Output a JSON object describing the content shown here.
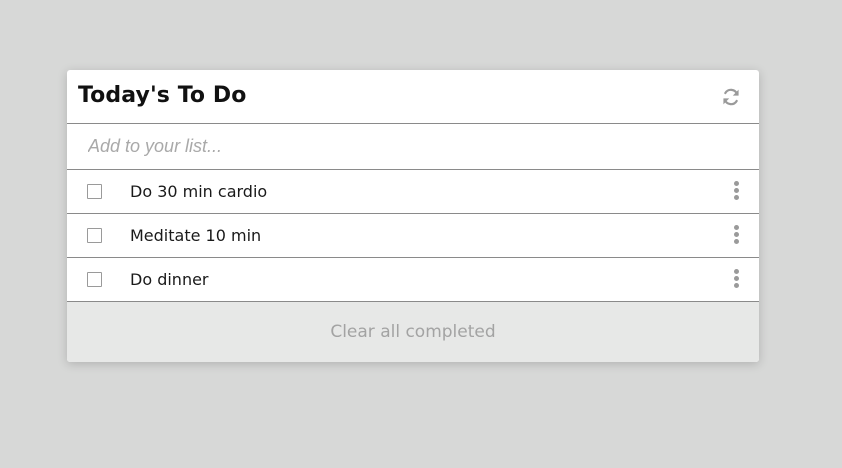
{
  "colors": {
    "page_background": "#d7d8d7",
    "card_background": "#ffffff",
    "footer_background": "#e7e8e7",
    "divider": "#8a8a8a",
    "icon_gray": "#9a9a9a"
  },
  "header": {
    "title": "Today's To Do",
    "refresh_icon": "refresh-icon"
  },
  "new_item": {
    "placeholder": "Add to your list...",
    "value": ""
  },
  "items": [
    {
      "label": "Do 30 min cardio",
      "checked": false
    },
    {
      "label": "Meditate 10 min",
      "checked": false
    },
    {
      "label": "Do dinner",
      "checked": false
    }
  ],
  "footer": {
    "clear_label": "Clear all completed"
  }
}
